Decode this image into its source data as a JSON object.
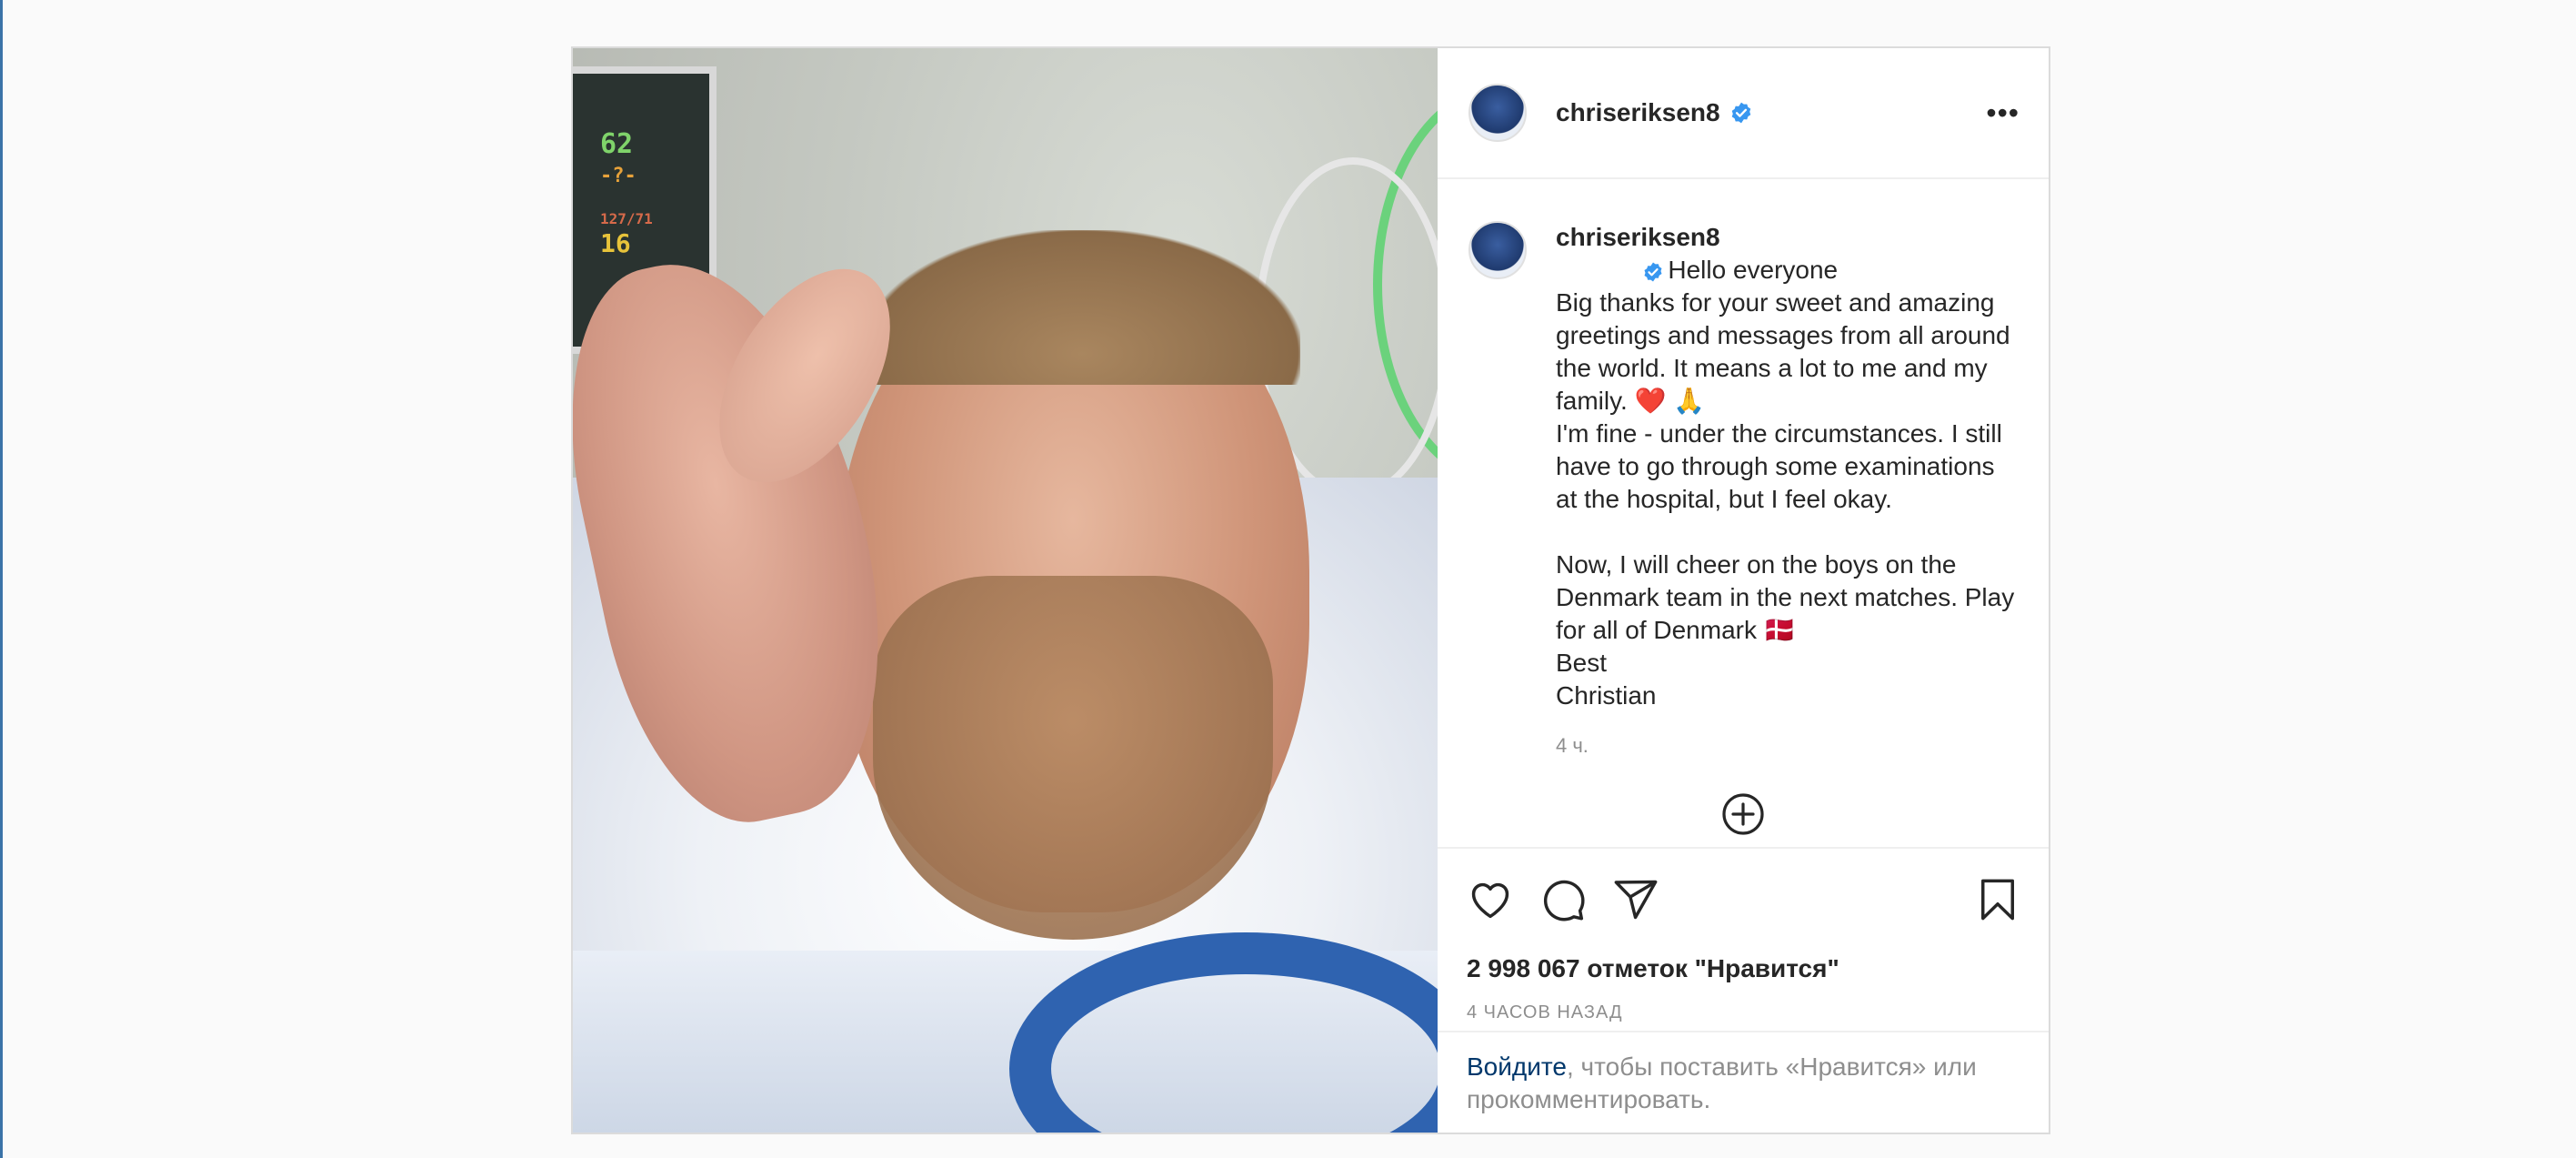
{
  "post": {
    "photo_alt": "",
    "monitor": [
      "62",
      "-?-",
      "127/71",
      "16"
    ],
    "author": {
      "username": "chriseriksen8",
      "verified": true
    },
    "caption": {
      "username": "chriseriksen8",
      "lines": [
        "Hello everyone",
        "Big thanks for your sweet and amazing greetings and messages from all around the world. It means a lot to me and my family. ❤️ 🙏",
        "I'm fine - under the circumstances. I still have to go through some examinations at the hospital, but I feel okay.",
        "",
        "Now, I will cheer on the boys on the Denmark team in the next matches. Play for all of Denmark 🇩🇰",
        "Best",
        "Christian"
      ],
      "time": "4 ч."
    },
    "likes": "2 998 067 отметок \"Нравится\"",
    "posted_ago": "4 ЧАСОВ НАЗАД",
    "login": {
      "link": "Войдите",
      "rest": ", чтобы поставить «Нравится» или прокомментировать."
    }
  },
  "icons": {
    "more": "more-options-icon",
    "verified": "verified-badge-icon",
    "like": "heart-icon",
    "comment": "comment-icon",
    "share": "paper-plane-icon",
    "save": "bookmark-icon",
    "load_more": "plus-circle-icon"
  },
  "colors": {
    "verified": "#3897f0",
    "link": "#00376b",
    "muted": "#8e8e8e",
    "border": "#dbdbdb"
  }
}
